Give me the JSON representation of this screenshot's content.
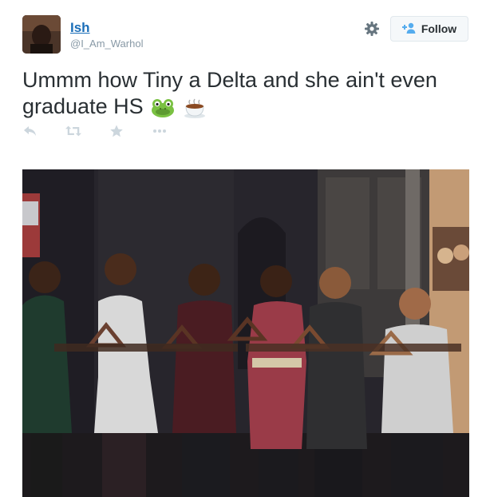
{
  "user": {
    "display_name": "Ish",
    "handle": "@I_Am_Warhol"
  },
  "header": {
    "settings_icon": "gear-icon",
    "follow_label": "Follow",
    "follow_icon": "add-user-icon"
  },
  "tweet": {
    "text": "Ummm how Tiny a Delta and she ain't even graduate HS",
    "emojis": [
      "frog-face-emoji",
      "hot-beverage-emoji"
    ]
  },
  "actions": [
    "reply-icon",
    "retweet-icon",
    "favorite-icon",
    "more-icon"
  ],
  "colors": {
    "link": "#1b6eb8",
    "muted": "#8899a6",
    "text": "#292f33",
    "action_icon": "#ccd6dd"
  }
}
